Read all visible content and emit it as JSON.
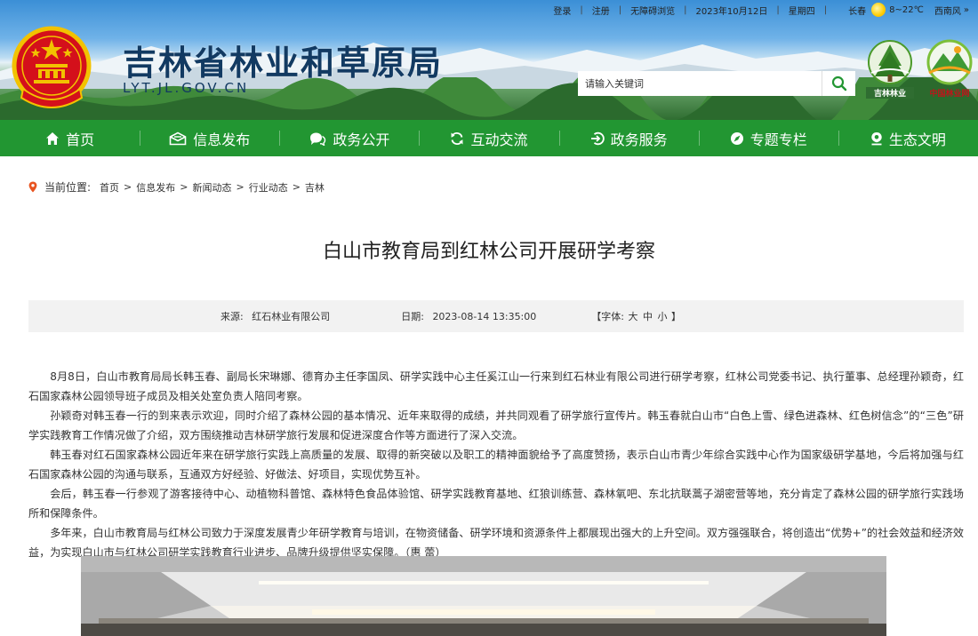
{
  "topbar": {
    "login": "登录",
    "register": "注册",
    "accessible": "无障碍浏览",
    "date": "2023年10月12日",
    "weekday": "星期四",
    "city": "长春",
    "temp_low": "8",
    "temp_high": "22℃",
    "wind": "西南风",
    "more": "»"
  },
  "header": {
    "site_title": "吉林省林业和草原局",
    "domain": "LYT.JL.GOV.CN",
    "logo1_label": "吉林林业",
    "logo2_label": "中国林业网"
  },
  "search": {
    "placeholder": "请输入关键词"
  },
  "nav": [
    {
      "label": "首页",
      "icon": "home-icon"
    },
    {
      "label": "信息发布",
      "icon": "message-icon"
    },
    {
      "label": "政务公开",
      "icon": "chat-icon"
    },
    {
      "label": "互动交流",
      "icon": "refresh-icon"
    },
    {
      "label": "政务服务",
      "icon": "login-arrow-icon"
    },
    {
      "label": "专题专栏",
      "icon": "compass-icon"
    },
    {
      "label": "生态文明",
      "icon": "location-icon"
    }
  ],
  "breadcrumb": {
    "label": "当前位置:",
    "items": [
      "首页",
      "信息发布",
      "新闻动态",
      "行业动态",
      "吉林"
    ],
    "separator": ">"
  },
  "article": {
    "title": "白山市教育局到红林公司开展研学考察",
    "source_label": "来源:",
    "source": "红石林业有限公司",
    "date_label": "日期:",
    "date": "2023-08-14 13:35:00",
    "font_label": "【字体:",
    "font_large": "大",
    "font_medium": "中",
    "font_small": "小",
    "font_close": "】",
    "paragraphs": [
      "8月8日，白山市教育局局长韩玉春、副局长宋琳娜、德育办主任李国凤、研学实践中心主任奚江山一行来到红石林业有限公司进行研学考察，红林公司党委书记、执行董事、总经理孙颖奇，红石国家森林公园领导班子成员及相关处室负责人陪同考察。",
      "孙颖奇对韩玉春一行的到来表示欢迎，同时介绍了森林公园的基本情况、近年来取得的成绩，并共同观看了研学旅行宣传片。韩玉春就白山市“白色上雪、绿色进森林、红色树信念”的“三色”研学实践教育工作情况做了介绍，双方围绕推动吉林研学旅行发展和促进深度合作等方面进行了深入交流。",
      "韩玉春对红石国家森林公园近年来在研学旅行实践上高质量的发展、取得的新突破以及职工的精神面貌给予了高度赞扬，表示白山市青少年综合实践中心作为国家级研学基地，今后将加强与红石国家森林公园的沟通与联系，互通双方好经验、好做法、好项目，实现优势互补。",
      "会后，韩玉春一行参观了游客接待中心、动植物科普馆、森林特色食品体验馆、研学实践教育基地、红狼训练营、森林氧吧、东北抗联蒿子湖密营等地，充分肯定了森林公园的研学旅行实践场所和保障条件。",
      "多年来，白山市教育局与红林公司致力于深度发展青少年研学教育与培训，在物资储备、研学环境和资源条件上都展现出强大的上升空间。双方强强联合，将创造出“优势+”的社会效益和经济效益，为实现白山市与红林公司研学实践教育行业进步、品牌升级提供坚实保障。（惠 蕾）"
    ]
  },
  "colors": {
    "nav_green": "#229632",
    "title_blue": "#123a62",
    "temp_orange": "#e85a00"
  }
}
